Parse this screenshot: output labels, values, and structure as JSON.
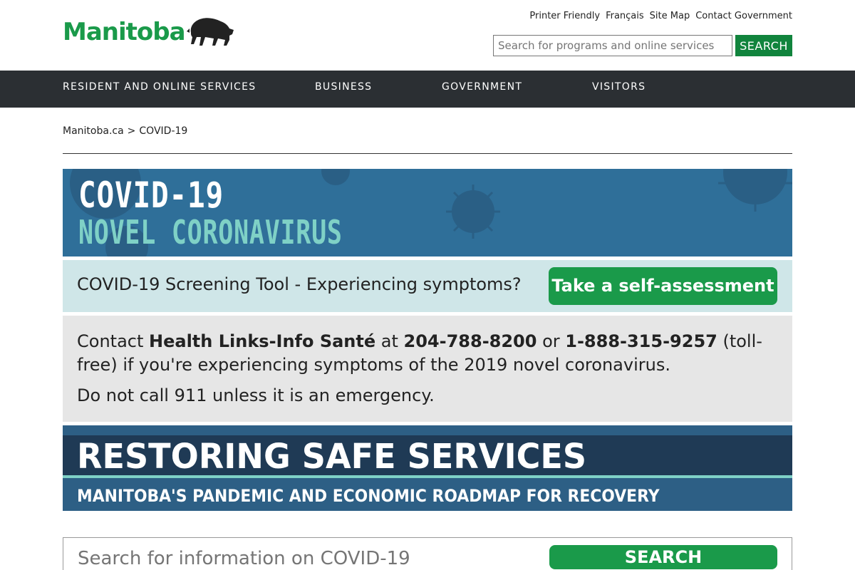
{
  "header": {
    "logo_text": "Manitoba",
    "utility_links": [
      "Printer Friendly",
      "Français",
      "Site Map",
      "Contact Government"
    ],
    "search_placeholder": "Search for programs and online services",
    "search_button": "SEARCH"
  },
  "nav": {
    "items": [
      "RESIDENT AND ONLINE SERVICES",
      "BUSINESS",
      "GOVERNMENT",
      "VISITORS"
    ]
  },
  "breadcrumb": {
    "items": [
      "Manitoba.ca",
      "COVID-19"
    ],
    "separator": ">"
  },
  "covid_banner": {
    "line1": "COVID-19",
    "line2": "NOVEL CORONAVIRUS"
  },
  "screening": {
    "text": "COVID-19 Screening Tool - Experiencing symptoms?",
    "button": "Take a self-assessment"
  },
  "contact": {
    "p1_a": "Contact ",
    "p1_b": "Health Links-Info Santé",
    "p1_c": " at ",
    "p1_d": "204-788-8200",
    "p1_e": " or ",
    "p1_f": "1-888-315-9257",
    "p1_g": " (toll-free) if you're experiencing symptoms of the 2019 novel coronavirus.",
    "p2": "Do not call 911 unless it is an emergency."
  },
  "restore_banner": {
    "title": "RESTORING SAFE SERVICES",
    "subtitle": "MANITOBA'S PANDEMIC AND ECONOMIC ROADMAP FOR RECOVERY"
  },
  "covid_search": {
    "placeholder": "Search for information on COVID-19",
    "button": "SEARCH"
  },
  "colors": {
    "brand_green": "#1a9a4a",
    "nav_bg": "#2b2f33",
    "banner_blue": "#2f6f99",
    "banner_teal": "#7fd1c6"
  }
}
